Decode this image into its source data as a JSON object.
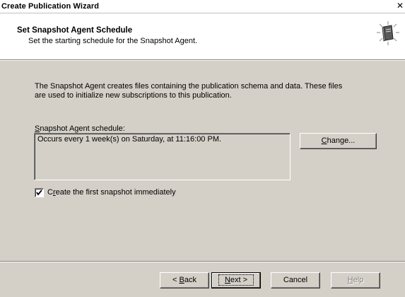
{
  "window": {
    "title": "Create Publication Wizard",
    "close_glyph": "✕"
  },
  "header": {
    "title": "Set Snapshot Agent Schedule",
    "subtitle": "Set the starting schedule for the Snapshot Agent.",
    "icon": "wizard-book-icon"
  },
  "body": {
    "description_line1": "The Snapshot Agent creates files containing the publication schema and data. These files",
    "description_line2": "are used to initialize new subscriptions to this publication.",
    "schedule_label_mnemonic": "S",
    "schedule_label_rest": "napshot Agent schedule:",
    "schedule_value": "Occurs every 1 week(s) on Saturday, at 11:16:00 PM.",
    "change_mnemonic": "C",
    "change_rest": "hange...",
    "checkbox_checked": true,
    "checkbox_label_pre": "C",
    "checkbox_label_mnemonic": "r",
    "checkbox_label_rest": "eate the first snapshot immediately"
  },
  "footer": {
    "back_pre": "< ",
    "back_mnemonic": "B",
    "back_rest": "ack",
    "next_mnemonic": "N",
    "next_rest": "ext >",
    "cancel_label": "Cancel",
    "help_mnemonic": "H",
    "help_rest": "elp",
    "help_enabled": false
  },
  "colors": {
    "face": "#d4d0c8",
    "header_bg": "#ffffff",
    "disabled_text": "#808080"
  }
}
